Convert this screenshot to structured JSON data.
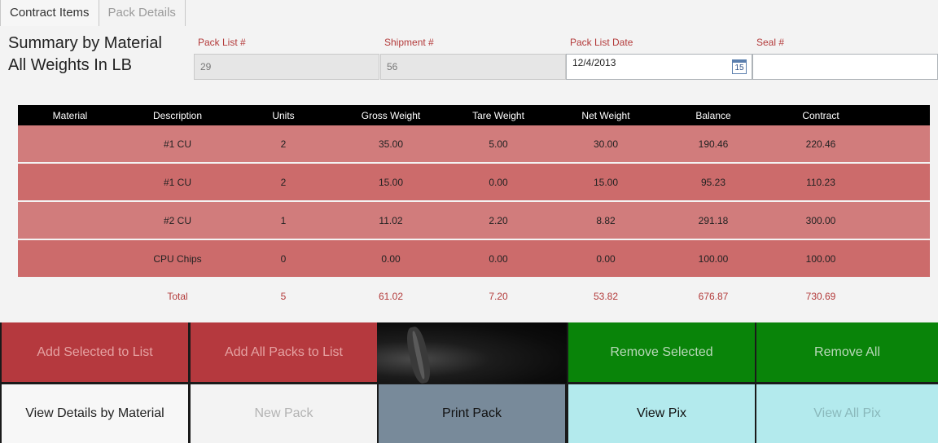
{
  "tabs": [
    {
      "label": "Contract Items"
    },
    {
      "label": "Pack Details"
    }
  ],
  "summary": {
    "line1": "Summary by Material",
    "line2": "All Weights In LB"
  },
  "fields": {
    "pack_list": {
      "label": "Pack List #",
      "value": "29"
    },
    "shipment": {
      "label": "Shipment #",
      "value": "56"
    },
    "pack_list_date": {
      "label": "Pack List Date",
      "value": "12/4/2013",
      "calendar_day": "15"
    },
    "seal": {
      "label": "Seal #",
      "value": ""
    }
  },
  "table": {
    "headers": [
      "Material",
      "Description",
      "Units",
      "Gross Weight",
      "Tare Weight",
      "Net Weight",
      "Balance",
      "Contract"
    ],
    "rows": [
      [
        "",
        "#1 CU",
        "2",
        "35.00",
        "5.00",
        "30.00",
        "190.46",
        "220.46"
      ],
      [
        "",
        "#1 CU",
        "2",
        "15.00",
        "0.00",
        "15.00",
        "95.23",
        "110.23"
      ],
      [
        "",
        "#2 CU",
        "1",
        "11.02",
        "2.20",
        "8.82",
        "291.18",
        "300.00"
      ],
      [
        "",
        "CPU Chips",
        "0",
        "0.00",
        "0.00",
        "0.00",
        "100.00",
        "100.00"
      ]
    ],
    "totals": [
      "",
      "Total",
      "5",
      "61.02",
      "7.20",
      "53.82",
      "676.87",
      "730.69"
    ]
  },
  "buttons": {
    "add_selected": "Add Selected to List",
    "add_all": "Add All Packs to List",
    "remove_selected": "Remove Selected",
    "remove_all": "Remove All",
    "view_details": "View Details by Material",
    "new_pack": "New Pack",
    "print_pack": "Print Pack",
    "view_pix": "View Pix",
    "view_all_pix": "View All Pix"
  },
  "colors": {
    "row_odd": "#d17c7c",
    "row_even": "#cc6b6b",
    "label_red": "#b33a3a",
    "button_red": "#b5393e",
    "button_green": "#098409",
    "button_slate": "#788a9a",
    "button_cyan": "#b3eaed"
  }
}
